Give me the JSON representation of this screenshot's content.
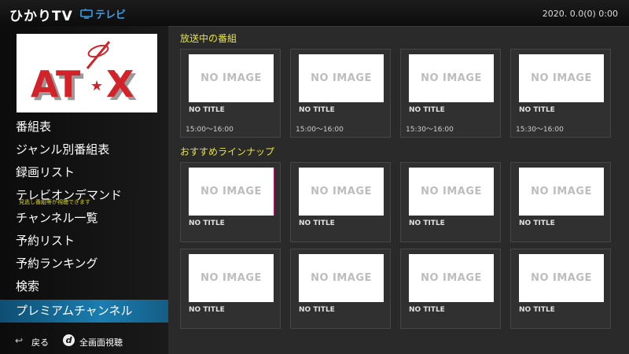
{
  "header": {
    "brand": "ひかりTV",
    "tv_label": "テレビ",
    "clock": "2020.  0.0(0)  0:00"
  },
  "channel": {
    "logo_text_left": "AT",
    "logo_text_right": "X",
    "logo_star": "★"
  },
  "menu": {
    "items": [
      {
        "label": "番組表"
      },
      {
        "label": "ジャンル別番組表"
      },
      {
        "label": "録画リスト"
      },
      {
        "label": "テレビオンデマンド",
        "sub": "見逃し番組等が視聴できます"
      },
      {
        "label": "チャンネル一覧"
      },
      {
        "label": "予約リスト"
      },
      {
        "label": "予約ランキング"
      },
      {
        "label": "検索"
      },
      {
        "label": "プレミアムチャンネル"
      }
    ]
  },
  "footer": {
    "back_icon": "↩",
    "back_label": "戻る",
    "d_icon": "d",
    "d_label": "全画面視聴"
  },
  "on_air": {
    "title": "放送中の番組",
    "cards": [
      {
        "image": "NO IMAGE",
        "title": "NO TITLE",
        "time": "15:00〜16:00"
      },
      {
        "image": "NO IMAGE",
        "title": "NO TITLE",
        "time": "15:00〜16:00"
      },
      {
        "image": "NO IMAGE",
        "title": "NO TITLE",
        "time": "15:30〜16:00"
      },
      {
        "image": "NO IMAGE",
        "title": "NO TITLE",
        "time": "15:30〜16:00"
      }
    ]
  },
  "recommended": {
    "title": "おすすめラインナップ",
    "cards": [
      {
        "image": "NO IMAGE",
        "title": "NO TITLE"
      },
      {
        "image": "NO IMAGE",
        "title": "NO TITLE"
      },
      {
        "image": "NO IMAGE",
        "title": "NO TITLE"
      },
      {
        "image": "NO IMAGE",
        "title": "NO TITLE"
      },
      {
        "image": "NO IMAGE",
        "title": "NO TITLE"
      },
      {
        "image": "NO IMAGE",
        "title": "NO TITLE"
      },
      {
        "image": "NO IMAGE",
        "title": "NO TITLE"
      },
      {
        "image": "NO IMAGE",
        "title": "NO TITLE"
      }
    ]
  },
  "colors": {
    "accent": "#1a7db0",
    "section_title": "#e8e43a",
    "tv_label": "#3aa0e8",
    "logo_red": "#d2232a"
  }
}
